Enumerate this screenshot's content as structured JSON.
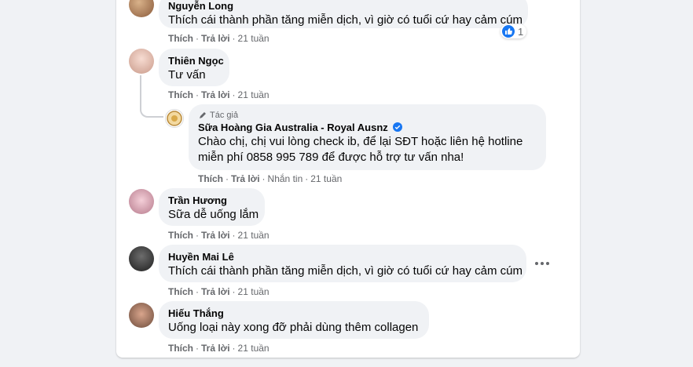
{
  "actions": {
    "like": "Thích",
    "reply": "Trả lời",
    "message": "Nhắn tin"
  },
  "reaction_count": "1",
  "comments": [
    {
      "name": "Nguyễn Long",
      "text": "Thích cái thành phần tăng miễn dịch, vì giờ có tuổi cứ hay cảm cúm",
      "time": "21 tuần"
    },
    {
      "name": "Thiên Ngọc",
      "text": "Tư vấn",
      "time": "21 tuần"
    },
    {
      "name": "Trần Hương",
      "text": "Sữa dễ uống lắm",
      "time": "21 tuần"
    },
    {
      "name": "Huyền Mai Lê",
      "text": "Thích cái thành phần tăng miễn dịch, vì giờ có tuổi cứ hay cảm cúm",
      "time": "21 tuần"
    },
    {
      "name": "Hiếu Thắng",
      "text": "Uống loại này xong đỡ phải dùng thêm collagen",
      "time": "21 tuần"
    }
  ],
  "reply": {
    "author_tag": "Tác giả",
    "name": "Sữa Hoàng Gia Australia - Royal Ausnz",
    "text_line1": "Chào chị, chị vui lòng check ib, để lại SĐT hoặc liên hệ hotline",
    "text_line2": "miễn phí 0858 995 789 để được hỗ trợ tư vấn nha!",
    "time": "21 tuần"
  },
  "colors": {
    "accent": "#1877f2",
    "bubble": "#f0f2f5",
    "meta": "#65676b"
  }
}
